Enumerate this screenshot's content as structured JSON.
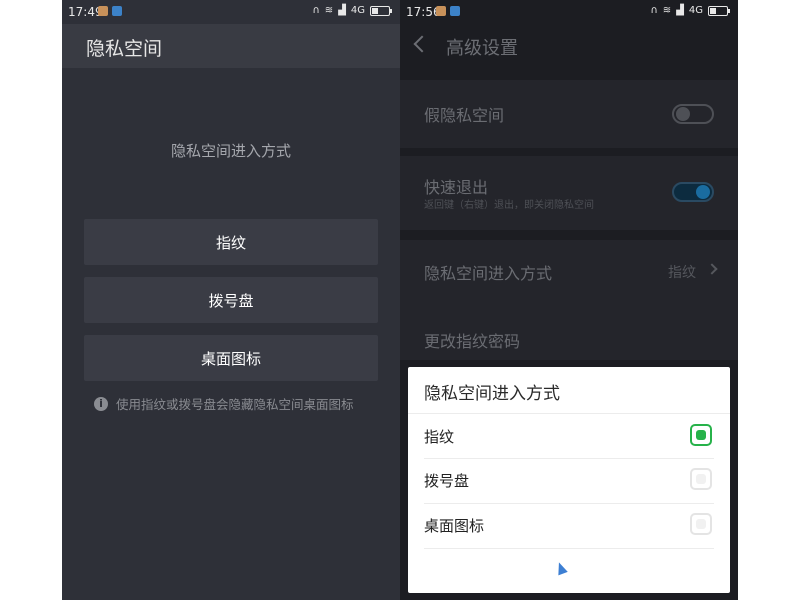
{
  "left": {
    "status": {
      "time": "17:49",
      "network": "4G"
    },
    "title": "隐私空间",
    "heading": "隐私空间进入方式",
    "options": [
      "指纹",
      "拨号盘",
      "桌面图标"
    ],
    "note": "使用指纹或拨号盘会隐藏隐私空间桌面图标"
  },
  "right": {
    "status": {
      "time": "17:56",
      "network": "4G"
    },
    "title": "高级设置",
    "rows": {
      "fake_space": {
        "label": "假隐私空间",
        "enabled": false
      },
      "quick_quit": {
        "label": "快速退出",
        "sub": "返回键（右键）退出，即关闭隐私空间",
        "enabled": true
      },
      "entry_mode": {
        "label": "隐私空间进入方式",
        "value": "指纹"
      },
      "change_pwd": {
        "label": "更改指纹密码"
      }
    },
    "dialog": {
      "title": "隐私空间进入方式",
      "options": [
        "指纹",
        "拨号盘",
        "桌面图标"
      ],
      "selected_index": 0
    }
  },
  "colors": {
    "accent_green": "#27b24a",
    "toggle_blue": "#1a6ca0",
    "left_bg": "#2e3038",
    "right_bg": "#1c1d22"
  }
}
